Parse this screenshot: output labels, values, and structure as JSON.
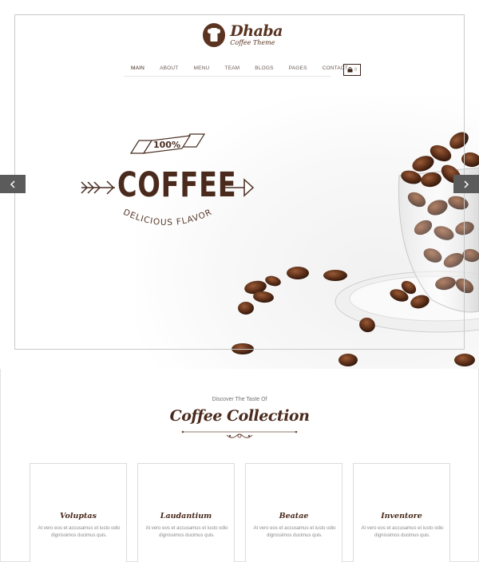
{
  "brand": {
    "name": "Dhaba",
    "tagline": "Coffee Theme"
  },
  "nav": {
    "items": [
      {
        "label": "MAIN"
      },
      {
        "label": "ABOUT"
      },
      {
        "label": "MENU"
      },
      {
        "label": "TEAM"
      },
      {
        "label": "BLOGS"
      },
      {
        "label": "PAGES"
      },
      {
        "label": "CONTACT"
      }
    ],
    "cart_count": "0"
  },
  "hero": {
    "badge": "100%",
    "headline": "COFFEE",
    "subline": "DELICIOUS FLAVOR"
  },
  "collection": {
    "kicker": "Discover The Taste Of",
    "title": "Coffee Collection",
    "cards": [
      {
        "title": "Voluptas",
        "text": "At vero eos et accusamus et iusto odio dignissimos ducimus quis."
      },
      {
        "title": "Laudantium",
        "text": "At vero eos et accusamus et iusto odio dignissimos ducimus quis."
      },
      {
        "title": "Beatae",
        "text": "At vero eos et accusamus et iusto odio dignissimos ducimus quis."
      },
      {
        "title": "Inventore",
        "text": "At vero eos et accusamus et iusto odio dignissimos ducimus quis."
      }
    ]
  },
  "colors": {
    "brand_brown": "#5a3321",
    "dark_brown": "#4a2a1c",
    "arrow_gray": "#5b5b5b"
  },
  "icons": [
    "chef-logo-icon",
    "cart-icon",
    "chevron-left-icon",
    "chevron-right-icon"
  ]
}
